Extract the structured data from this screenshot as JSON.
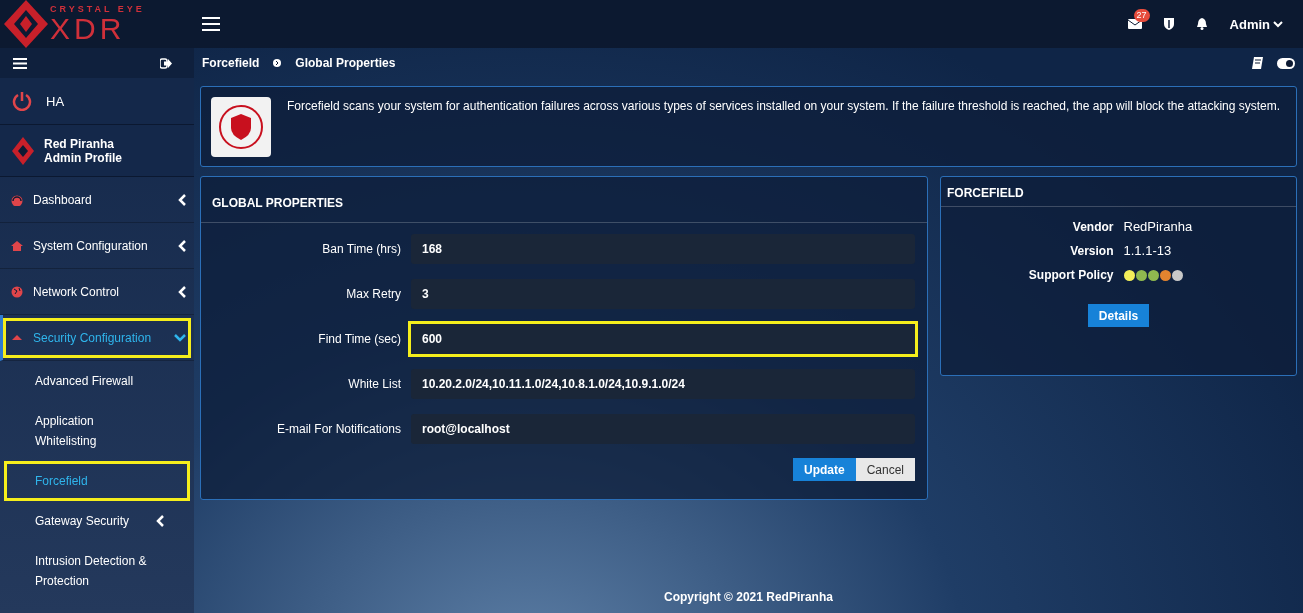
{
  "logo": {
    "top": "CRYSTAL EYE",
    "main": "XDR"
  },
  "header": {
    "mail_count": "27",
    "user": "Admin"
  },
  "sidebar": {
    "ha": "HA",
    "profile": {
      "name": "Red Piranha",
      "role": "Admin Profile"
    },
    "items": [
      {
        "label": "Dashboard",
        "expanded": false,
        "selected": false,
        "highlighted": false
      },
      {
        "label": "System Configuration",
        "expanded": false,
        "selected": false,
        "highlighted": false
      },
      {
        "label": "Network Control",
        "expanded": false,
        "selected": false,
        "highlighted": false
      },
      {
        "label": "Security Configuration",
        "expanded": true,
        "selected": true,
        "highlighted": true,
        "children": [
          {
            "label": "Advanced Firewall",
            "selected": false,
            "highlighted": false,
            "has_sub": false
          },
          {
            "label": "Application Whitelisting",
            "selected": false,
            "highlighted": false,
            "has_sub": false
          },
          {
            "label": "Forcefield",
            "selected": true,
            "highlighted": true,
            "has_sub": false
          },
          {
            "label": "Gateway Security",
            "selected": false,
            "highlighted": false,
            "has_sub": true
          },
          {
            "label": "Intrusion Detection & Protection",
            "selected": false,
            "highlighted": false,
            "has_sub": false
          }
        ]
      }
    ]
  },
  "breadcrumb": [
    "Forcefield",
    "Global Properties"
  ],
  "info": "Forcefield scans your system for authentication failures across various types of services installed on your system. If the failure threshold is reached, the app will block the attacking system.",
  "global_properties": {
    "title": "GLOBAL PROPERTIES",
    "fields": [
      {
        "label": "Ban Time (hrs)",
        "value": "168",
        "highlighted": false
      },
      {
        "label": "Max Retry",
        "value": "3",
        "highlighted": false
      },
      {
        "label": "Find Time (sec)",
        "value": "600",
        "highlighted": true
      },
      {
        "label": "White List",
        "value": "10.20.2.0/24,10.11.1.0/24,10.8.1.0/24,10.9.1.0/24",
        "highlighted": false
      },
      {
        "label": "E-mail For Notifications",
        "value": "root@localhost",
        "highlighted": false
      }
    ],
    "buttons": [
      "Update",
      "Cancel"
    ]
  },
  "app_panel": {
    "title": "FORCEFIELD",
    "rows": [
      {
        "label": "Vendor",
        "value": "RedPiranha"
      },
      {
        "label": "Version",
        "value": "1.1.1-13"
      }
    ],
    "support_label": "Support Policy",
    "support_dots": [
      {
        "color": "#f2ee5a"
      },
      {
        "color": "#8fb94f"
      },
      {
        "color": "#8fb94f"
      },
      {
        "color": "#e2842f"
      },
      {
        "color": "#c8c8c8"
      }
    ],
    "button": "Details"
  },
  "footer": "Copyright © 2021 RedPiranha"
}
